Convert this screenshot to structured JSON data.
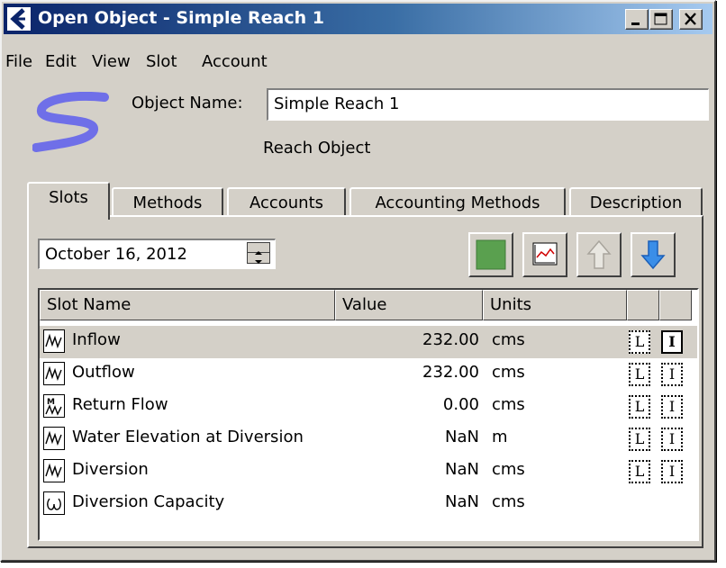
{
  "window": {
    "title": "Open Object - Simple Reach 1"
  },
  "menu": [
    "File",
    "Edit",
    "View",
    "Slot",
    "Account"
  ],
  "object": {
    "name_label": "Object Name:",
    "name_value": "Simple Reach 1",
    "type_label": "Reach Object"
  },
  "tabs": [
    {
      "label": "Slots",
      "active": true
    },
    {
      "label": "Methods",
      "active": false
    },
    {
      "label": "Accounts",
      "active": false
    },
    {
      "label": "Accounting Methods",
      "active": false
    },
    {
      "label": "Description",
      "active": false
    }
  ],
  "date": {
    "value": "October 16, 2012"
  },
  "toolbar": {
    "green_icon": "green-square-icon",
    "plot_icon": "plot-icon",
    "up_icon": "up-arrow-icon",
    "down_icon": "down-arrow-icon"
  },
  "table": {
    "columns": [
      "Slot Name",
      "Value",
      "Units",
      "",
      ""
    ],
    "rows": [
      {
        "name": "Inflow",
        "value": "232.00",
        "units": "cms",
        "icon": "series-slot-icon",
        "flag1": "L",
        "flag2": "I",
        "flag2_solid": true,
        "selected": true
      },
      {
        "name": "Outflow",
        "value": "232.00",
        "units": "cms",
        "icon": "series-slot-icon",
        "flag1": "L",
        "flag2": "I",
        "flag2_solid": false,
        "selected": false
      },
      {
        "name": "Return Flow",
        "value": "0.00",
        "units": "cms",
        "icon": "multi-slot-icon",
        "flag1": "L",
        "flag2": "I",
        "flag2_solid": false,
        "selected": false
      },
      {
        "name": "Water Elevation at Diversion",
        "value": "NaN",
        "units": "m",
        "icon": "series-slot-icon",
        "flag1": "L",
        "flag2": "I",
        "flag2_solid": false,
        "selected": false
      },
      {
        "name": "Diversion",
        "value": "NaN",
        "units": "cms",
        "icon": "series-slot-icon",
        "flag1": "L",
        "flag2": "I",
        "flag2_solid": false,
        "selected": false
      },
      {
        "name": "Diversion Capacity",
        "value": "NaN",
        "units": "cms",
        "icon": "scalar-slot-icon",
        "flag1": "",
        "flag2": "",
        "flag2_solid": false,
        "selected": false
      }
    ]
  }
}
